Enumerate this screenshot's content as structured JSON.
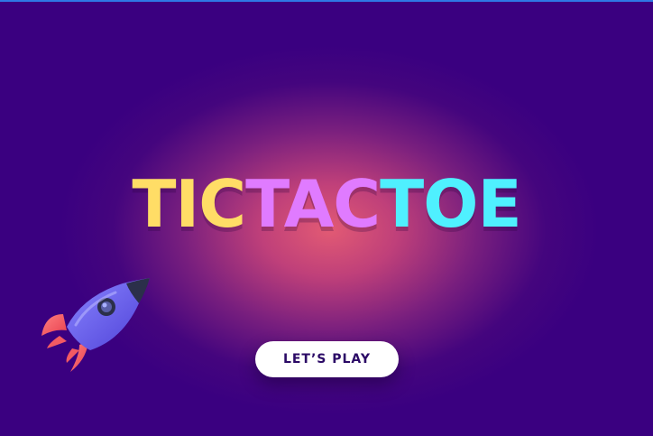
{
  "title": {
    "part1": "TIC",
    "part2": "TAC",
    "part3": "TOE"
  },
  "colors": {
    "background": "#3a0080",
    "glow": "#e65f73",
    "tic": "#ffdd66",
    "tac": "#e07bff",
    "toe": "#4ff0ff",
    "button_text": "#2b0a66"
  },
  "play_button": {
    "label": "LET’S PLAY"
  },
  "icons": {
    "rocket": "rocket-icon"
  }
}
